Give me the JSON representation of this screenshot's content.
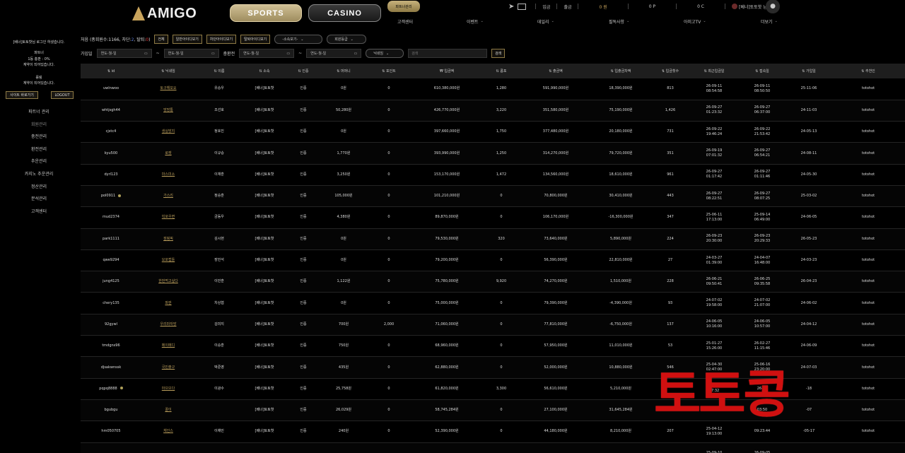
{
  "brand": "AMIGO",
  "top": {
    "sports": "SPORTS",
    "casino": "CASINO",
    "partner": "파트너관리",
    "deposit": "입금",
    "withdraw": "출금",
    "money": "0 원",
    "points": "0 P",
    "casino_money": "0 C",
    "user": "[베너]토토핫 님",
    "nav": [
      {
        "label": "고객센터",
        "chev": false
      },
      {
        "label": "이벤트",
        "chev": true
      },
      {
        "label": "데일리",
        "chev": true
      },
      {
        "label": "필독사항",
        "chev": true
      },
      {
        "label": "아미고TV",
        "chev": true
      },
      {
        "label": "더보기",
        "chev": true
      }
    ]
  },
  "sidebar": {
    "login_msg": "[베너]토토핫님 로그인 하셨습니다.",
    "partner_title": "파트너",
    "partner_rate": "1등 총판 : 0%",
    "partner_note": "계약이 되어있습니다.",
    "rolling_title": "롤링",
    "rolling_note": "계약이 되어있습니다.",
    "site_move": "사이트 바로가기",
    "logout": "LOGOUT",
    "menu": [
      "파트너 관리",
      "회원관리",
      "충전관리",
      "환전관리",
      "추운관리",
      "카지노 추운관리",
      "정산관리",
      "분석관리",
      "고객센터"
    ]
  },
  "filters": {
    "member_summary_label": "처음",
    "member_total": "(총회원수:1166, 차단:",
    "blocked": "2",
    "withdrawn_label": ", 탈퇴:",
    "withdrawn": "0",
    "close_paren": ")",
    "buttons": [
      "전체",
      "일반아이디보기",
      "차단아이디보기",
      "탈퇴아이디보기"
    ],
    "affiliation_select": "-소속보기-",
    "grade_select": "회원등급",
    "join_label": "가입일",
    "charge_label": "충환전",
    "date_placeholder": "연도-월-일",
    "tilde": "~",
    "nickname_select": "닉네임",
    "search_placeholder": "검색",
    "search_button": "검색"
  },
  "table": {
    "headers": [
      "⇅ id",
      "⇅ 닉네임",
      "⇅ 이름",
      "⇅ 소속",
      "⇅ 인증",
      "⇅ 머머니",
      "⇅ 포인트",
      "₩ 입금액",
      "⇅ 콤포",
      "⇅ 출금액",
      "⇅ 입출금차액",
      "⇅ 입금횟수",
      "⇅ 최근입금일",
      "⇅ 접속일",
      "⇅ 가입일",
      "⇅ 추천인"
    ],
    "rows": [
      [
        "uwlnwoo",
        "토구해보요",
        "유승우",
        "[베너]토토핫",
        "인증",
        "0원",
        "0",
        "610,380,000원",
        "1,280",
        "591,990,000원",
        "18,390,000원",
        "813",
        "26-09-11 08:54:58",
        "26-09-11 08:50:50",
        "25-11-06",
        "totohot",
        false
      ],
      [
        "whtjsgh44",
        "망망통",
        "조선호",
        "[베너]토토핫",
        "인증",
        "50,280원",
        "0",
        "426,770,000원",
        "3,220",
        "351,580,000원",
        "75,190,000원",
        "1,426",
        "26-09-27 01:23:32",
        "26-09-27 06:37:00",
        "24-11-03",
        "totohot",
        false
      ],
      [
        "cjstc4",
        "생실망지",
        "정호진",
        "[베너]토토핫",
        "인증",
        "0원",
        "0",
        "397,660,000원",
        "1,750",
        "377,480,000원",
        "20,180,000원",
        "731",
        "26-09-22 19:46:24",
        "26-09-22 21:53:42",
        "24-05-13",
        "totohot",
        false
      ],
      [
        "kyu500",
        "로켓",
        "이규승",
        "[베너]토토핫",
        "인증",
        "1,770원",
        "0",
        "393,990,000원",
        "1,250",
        "314,270,000원",
        "79,720,000원",
        "351",
        "26-09-19 07:01:32",
        "26-09-27 06:54:21",
        "24-08-11",
        "totohot",
        false
      ],
      [
        "dyrl123",
        "마스미소",
        "이재훈",
        "[베너]토토핫",
        "인증",
        "3,250원",
        "0",
        "153,170,000원",
        "1,472",
        "134,560,000원",
        "18,610,000원",
        "961",
        "26-09-27 01:17:42",
        "26-09-27 01:11:46",
        "24-05-30",
        "totohot",
        false
      ],
      [
        "pol0911",
        "가스리",
        "정승훈",
        "[베너]토토핫",
        "인증",
        "105,000원",
        "0",
        "101,210,000원",
        "0",
        "70,800,000원",
        "30,410,000원",
        "443",
        "26-09-27 08:22:51",
        "26-09-27 08:07:25",
        "25-03-02",
        "totohot",
        true
      ],
      [
        "mud2374",
        "빅포우면",
        "금동우",
        "[베너]토토핫",
        "인증",
        "4,380원",
        "0",
        "89,870,000원",
        "0",
        "106,170,000원",
        "-16,300,000원",
        "347",
        "25-06-11 17:13:00",
        "25-09-14 06:49:00",
        "24-06-05",
        "totohot",
        false
      ],
      [
        "park1111",
        "점핑픽",
        "김시현",
        "[베너]토토핫",
        "인증",
        "0원",
        "0",
        "79,530,000원",
        "320",
        "73,640,000원",
        "5,890,000원",
        "224",
        "26-09-23 20:30:00",
        "26-09-23 20:29:33",
        "26-05-23",
        "totohot",
        false
      ],
      [
        "qwe9294",
        "모포캡틀",
        "장민석",
        "[베너]토토핫",
        "인증",
        "0원",
        "0",
        "79,200,000원",
        "0",
        "56,390,000원",
        "22,810,000원",
        "27",
        "24-03-27 01:39:00",
        "24-04-07 16:48:00",
        "24-03-23",
        "totohot",
        false
      ],
      [
        "jung4125",
        "한번먹고싶다",
        "이민훈",
        "[베너]토토핫",
        "인증",
        "1,122원",
        "0",
        "75,780,000원",
        "9,920",
        "74,270,000원",
        "1,510,000원",
        "228",
        "26-06-21 09:50:41",
        "26-06-25 09:35:58",
        "26-04-23",
        "totohot",
        false
      ],
      [
        "chery135",
        "파판",
        "차상협",
        "[베너]토토핫",
        "인증",
        "0원",
        "0",
        "75,000,000원",
        "0",
        "79,390,000원",
        "-4,390,000원",
        "93",
        "24-07-02 19:58:00",
        "24-07-02 21:07:00",
        "24-06-02",
        "totohot",
        false
      ],
      [
        "92gywl",
        "우리마자망",
        "김미지",
        "[베너]토토핫",
        "인증",
        "700원",
        "2,000",
        "71,060,000원",
        "0",
        "77,810,000원",
        "-6,750,000원",
        "137",
        "24-06-05 10:16:00",
        "24-06-05 10:57:00",
        "24-04-12",
        "totohot",
        false
      ],
      [
        "tmdgns96",
        "메이메디",
        "이승훈",
        "[베너]토토핫",
        "인증",
        "750원",
        "0",
        "68,960,000원",
        "0",
        "57,950,000원",
        "11,010,000원",
        "53",
        "25-01-27 15:26:00",
        "26-02-27 11:15:46",
        "24-06-09",
        "totohot",
        false
      ],
      [
        "djsakwnssk",
        "국민출구",
        "박준영",
        "[베너]토토핫",
        "인증",
        "435원",
        "0",
        "62,880,000원",
        "0",
        "52,000,000원",
        "10,880,000원",
        "546",
        "25-04-30 02:47:00",
        "25-06-16 23:20:00",
        "24-07-03",
        "totohot",
        false
      ],
      [
        "pqpq8888",
        "마므므다",
        "이광수",
        "[베너]토토핫",
        "인증",
        "25,758원",
        "0",
        "61,820,000원",
        "3,300",
        "56,610,000원",
        "5,210,000원",
        "",
        "26-09 07:32",
        "26-09",
        "-18",
        "totohot",
        true
      ],
      [
        "bgubgu",
        "꿀이",
        "",
        "[베너]토토핫",
        "인증",
        "26,029원",
        "0",
        "58,745,284원",
        "0",
        "27,100,000원",
        "31,645,284원",
        "",
        "04:09:3",
        "03:50",
        "-07",
        "totohot",
        false
      ],
      [
        "hm050705",
        "체인스",
        "이채민",
        "[베너]토토핫",
        "인증",
        "240원",
        "0",
        "52,390,000원",
        "0",
        "44,180,000원",
        "8,210,000원",
        "207",
        "25-04-12 19:13:00",
        "09:23:44",
        "-05-17",
        "totohot",
        false
      ],
      [
        "",
        "",
        "",
        "",
        "",
        "",
        "",
        "",
        "",
        "",
        "",
        "",
        "25-09-10",
        "26-09-05",
        "",
        "",
        false
      ]
    ]
  },
  "watermark": "토토콩"
}
